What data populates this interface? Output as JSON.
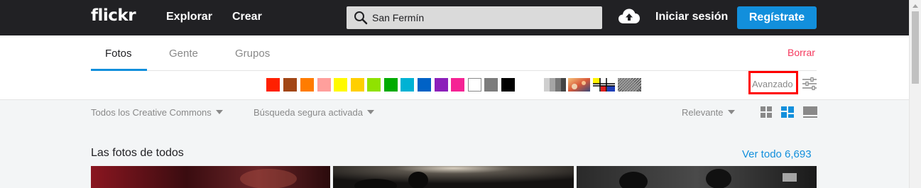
{
  "header": {
    "logo": "flickr",
    "nav": [
      "Explorar",
      "Crear"
    ],
    "search": {
      "value": "San Fermín",
      "icon": "search-icon"
    },
    "upload_icon": "cloud-upload-icon",
    "signin": "Iniciar sesión",
    "signup": "Regístrate"
  },
  "tabs": [
    {
      "label": "Fotos",
      "active": true
    },
    {
      "label": "Gente",
      "active": false
    },
    {
      "label": "Grupos",
      "active": false
    }
  ],
  "clear_label": "Borrar",
  "colors": [
    "#ff2000",
    "#a24615",
    "#ff7c00",
    "#ff9f9c",
    "#fffa00",
    "#ffcf00",
    "#90e200",
    "#00ab00",
    "#00b2d4",
    "#0062c6",
    "#8c20ba",
    "#f52394",
    "#ffffff",
    "#7c7c7c",
    "#000000"
  ],
  "style_filters": [
    "black-and-white",
    "shallow-depth-of-field",
    "minimalist",
    "patterns"
  ],
  "advanced_label": "Avanzado",
  "filters": {
    "license": "Todos los Creative Commons",
    "safe_search": "Búsqueda segura activada",
    "sort": "Relevante"
  },
  "section": {
    "title": "Las fotos de todos",
    "view_all": "Ver todo 6,693"
  }
}
